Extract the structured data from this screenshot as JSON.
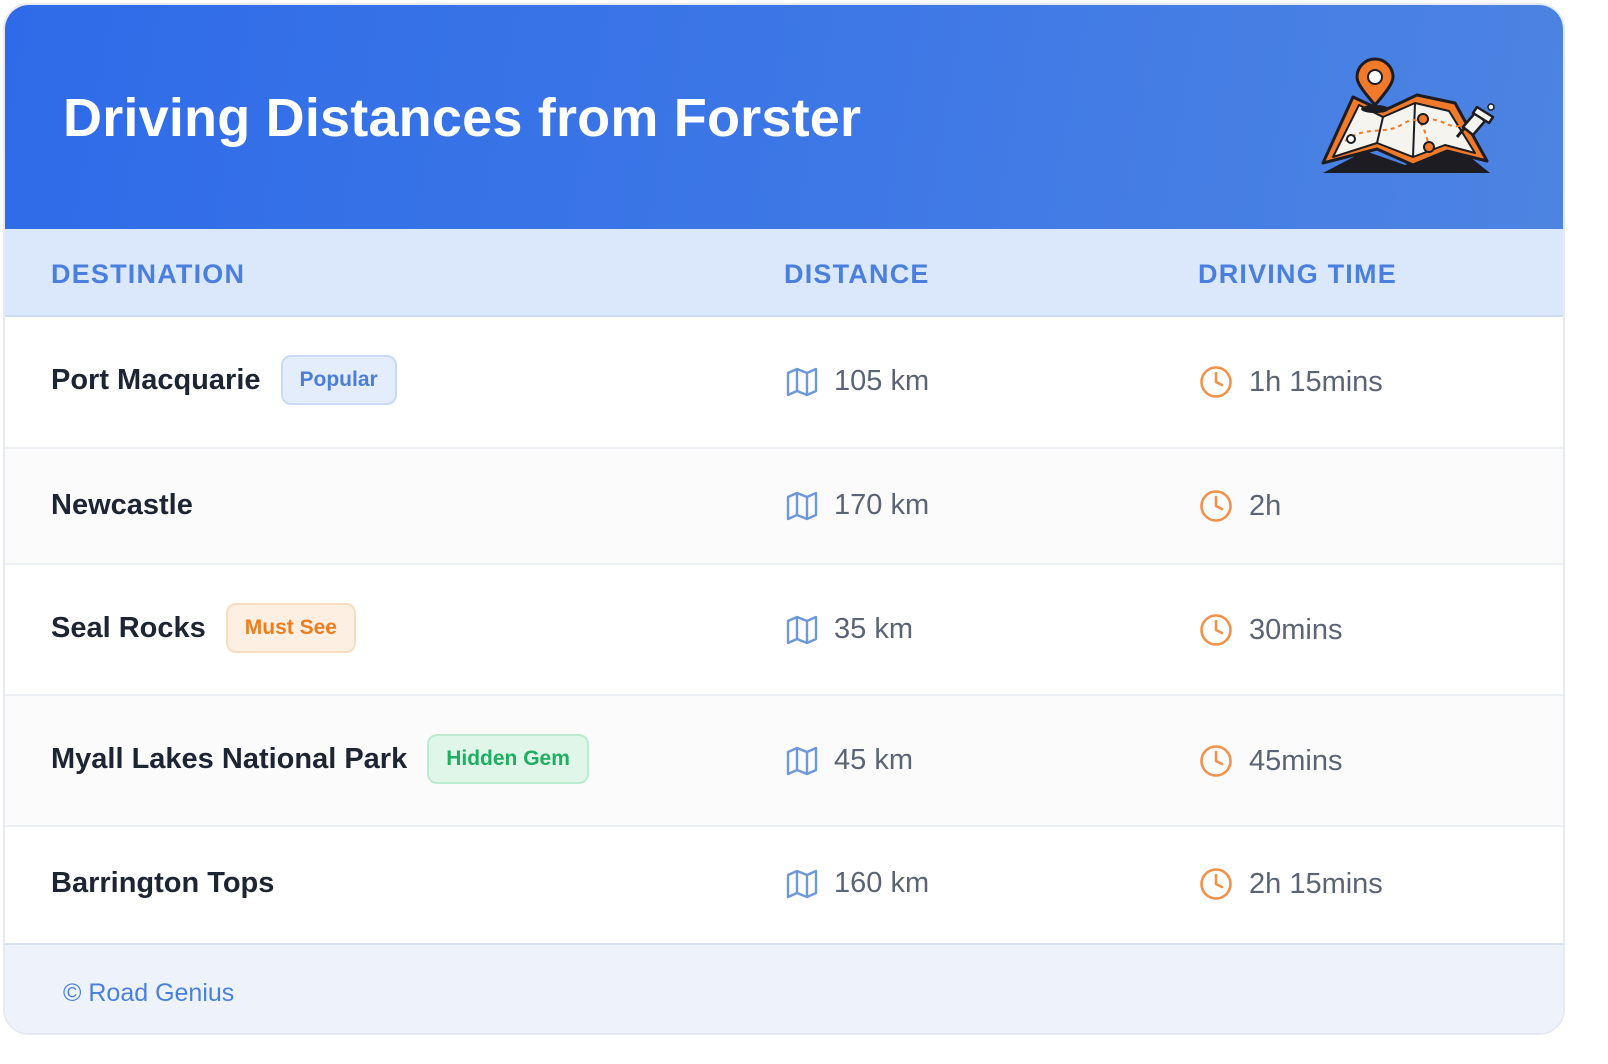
{
  "header": {
    "title": "Driving Distances from Forster",
    "illustration_icon": "map-with-pins-icon"
  },
  "table": {
    "columns": [
      "DESTINATION",
      "DISTANCE",
      "DRIVING TIME"
    ],
    "rows": [
      {
        "destination": "Port Macquarie",
        "badge": "Popular",
        "badge_color": "blue",
        "distance": "105 km",
        "time": "1h 15mins"
      },
      {
        "destination": "Newcastle",
        "badge": "",
        "badge_color": "",
        "distance": "170 km",
        "time": "2h"
      },
      {
        "destination": "Seal Rocks",
        "badge": "Must See",
        "badge_color": "orange",
        "distance": "35 km",
        "time": "30mins"
      },
      {
        "destination": "Myall Lakes National Park",
        "badge": "Hidden Gem",
        "badge_color": "green",
        "distance": "45 km",
        "time": "45mins"
      },
      {
        "destination": "Barrington Tops",
        "badge": "",
        "badge_color": "",
        "distance": "160 km",
        "time": "2h 15mins"
      }
    ],
    "distance_icon": "map-icon",
    "time_icon": "clock-icon"
  },
  "footer": {
    "copyright": "© Road Genius"
  },
  "colors": {
    "header_blue": "#2f6be8",
    "accent_blue": "#4a7fdd",
    "accent_orange": "#ef7d1f",
    "accent_green": "#1fae62"
  }
}
